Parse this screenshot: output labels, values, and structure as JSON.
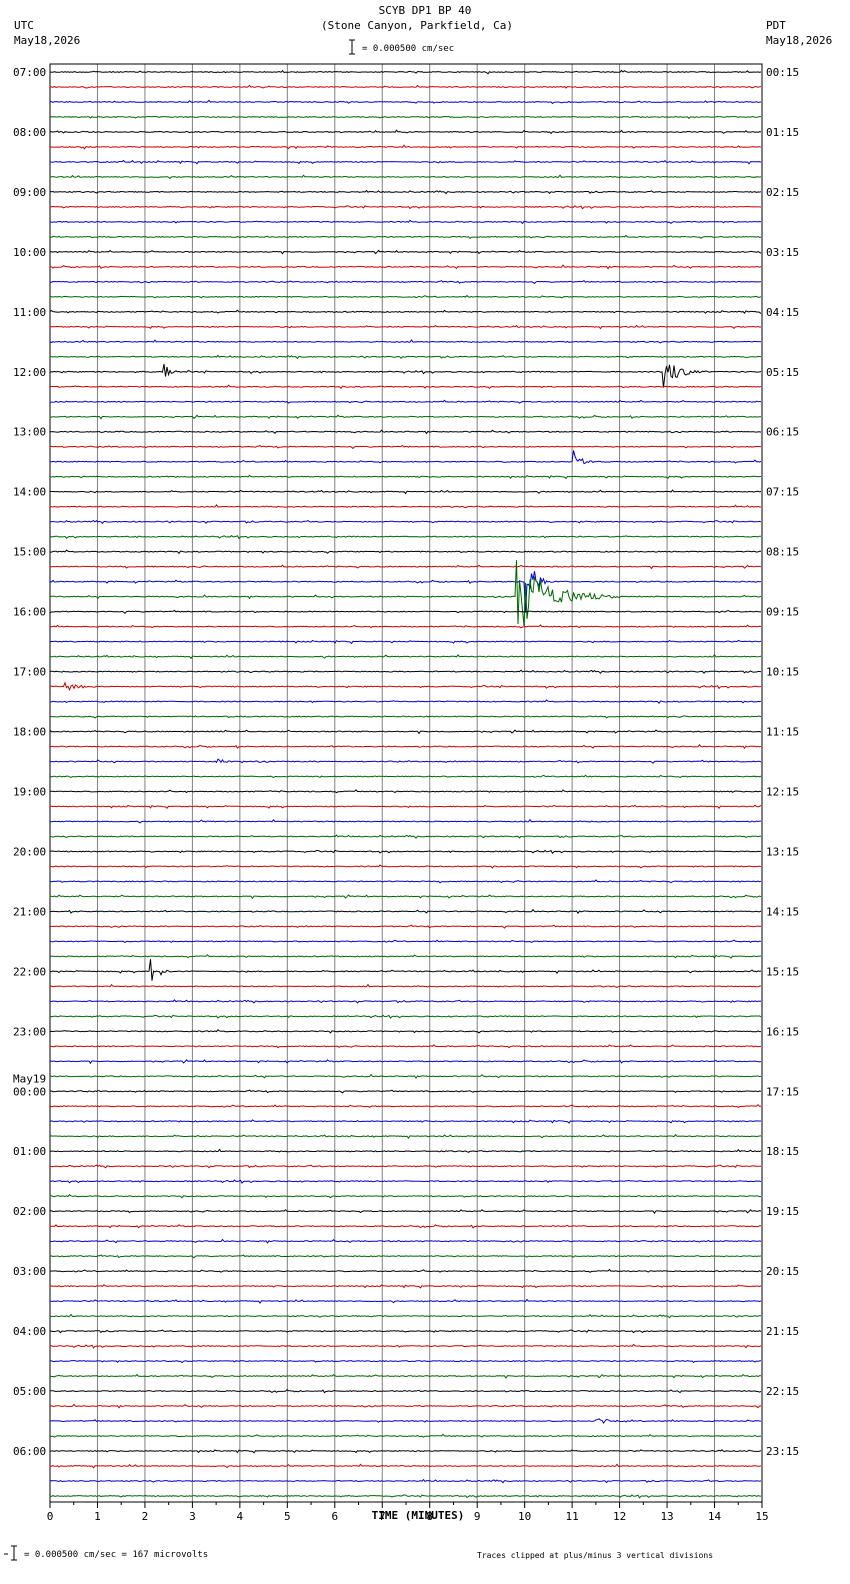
{
  "header": {
    "title": "SCYB DP1 BP 40",
    "subtitle": "(Stone Canyon, Parkfield, Ca)",
    "scale_label": "= 0.000500 cm/sec",
    "left_tz": "UTC",
    "left_date": "May18,2026",
    "right_tz": "PDT",
    "right_date": "May18,2026"
  },
  "footer": {
    "scale_note": "= 0.000500 cm/sec =     167 microvolts",
    "clip_note": "Traces clipped at plus/minus 3 vertical divisions"
  },
  "colors": {
    "trace_cycle": [
      "#000000",
      "#cc0000",
      "#0000cc",
      "#006600"
    ],
    "grid": "#808080"
  },
  "chart_data": {
    "type": "line",
    "xlabel": "TIME (MINUTES)",
    "xlim": [
      0,
      15
    ],
    "x_ticks": [
      "0",
      "1",
      "2",
      "3",
      "4",
      "5",
      "6",
      "7",
      "8",
      "9",
      "10",
      "11",
      "12",
      "13",
      "14",
      "15"
    ],
    "row_count": 96,
    "rows_per_hour": 4,
    "color_cycle": [
      "black",
      "red",
      "blue",
      "green"
    ],
    "utc_hour_labels": [
      "07:00",
      "08:00",
      "09:00",
      "10:00",
      "11:00",
      "12:00",
      "13:00",
      "14:00",
      "15:00",
      "16:00",
      "17:00",
      "18:00",
      "19:00",
      "20:00",
      "21:00",
      "22:00",
      "23:00",
      "00:00",
      "01:00",
      "02:00",
      "03:00",
      "04:00",
      "05:00",
      "06:00"
    ],
    "utc_date_change": {
      "hour_index": 17,
      "label": "May19"
    },
    "pdt_hour_labels": [
      "00:15",
      "01:15",
      "02:15",
      "03:15",
      "04:15",
      "05:15",
      "06:15",
      "07:15",
      "08:15",
      "09:15",
      "10:15",
      "11:15",
      "12:15",
      "13:15",
      "14:15",
      "15:15",
      "16:15",
      "17:15",
      "18:15",
      "19:15",
      "20:15",
      "21:15",
      "22:15",
      "23:15"
    ],
    "events": [
      {
        "row": 20,
        "minute": 2.4,
        "amplitude": 0.6,
        "duration": 0.5
      },
      {
        "row": 20,
        "minute": 12.9,
        "amplitude": 1.6,
        "duration": 1.0
      },
      {
        "row": 26,
        "minute": 11.0,
        "amplitude": 0.9,
        "duration": 0.6
      },
      {
        "row": 35,
        "minute": 9.8,
        "amplitude": 3.0,
        "duration": 2.3
      },
      {
        "row": 34,
        "minute": 10.0,
        "amplitude": 3.0,
        "duration": 0.6
      },
      {
        "row": 41,
        "minute": 0.3,
        "amplitude": 0.4,
        "duration": 0.8
      },
      {
        "row": 46,
        "minute": 3.5,
        "amplitude": 0.3,
        "duration": 0.7
      },
      {
        "row": 60,
        "minute": 2.1,
        "amplitude": 1.3,
        "duration": 0.6
      },
      {
        "row": 90,
        "minute": 11.5,
        "amplitude": 0.3,
        "duration": 0.8
      }
    ]
  }
}
